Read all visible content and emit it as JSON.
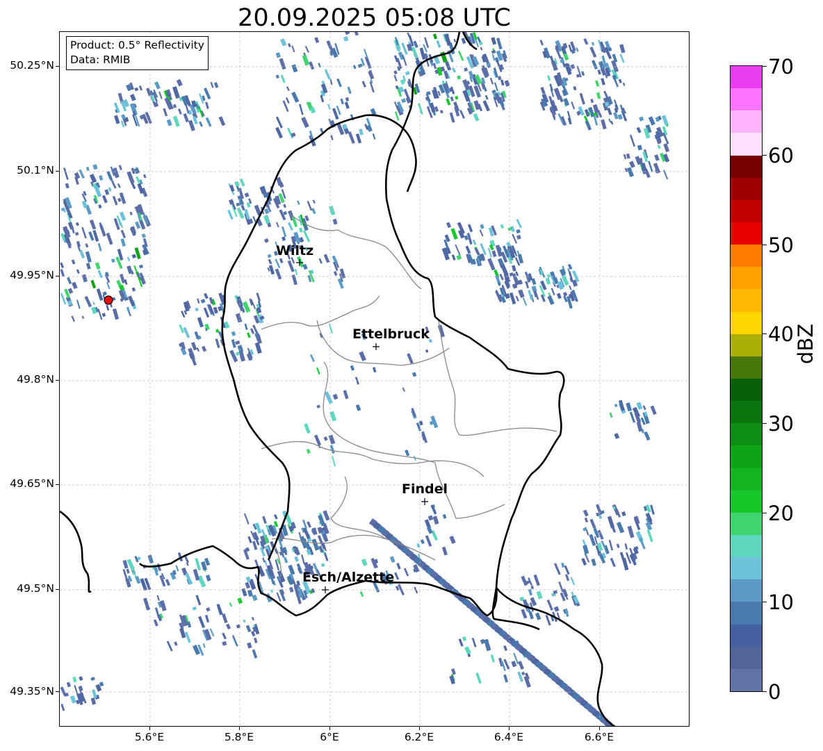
{
  "title": "20.09.2025 05:08 UTC",
  "info": {
    "product": "Product: 0.5° Reflectivity",
    "data": "Data: RMIB"
  },
  "axes": {
    "lat_labels": [
      "50.25°N",
      "50.1°N",
      "49.95°N",
      "49.8°N",
      "49.65°N",
      "49.5°N",
      "49.35°N"
    ],
    "lon_labels": [
      "5.6°E",
      "5.8°E",
      "6°E",
      "6.2°E",
      "6.4°E",
      "6.6°E"
    ]
  },
  "colorbar": {
    "label": "dBZ",
    "ticks": [
      "0",
      "10",
      "20",
      "30",
      "40",
      "50",
      "60",
      "70"
    ],
    "colors": [
      "#6473a6",
      "#52659b",
      "#4460a2",
      "#4a7aad",
      "#5b9ac4",
      "#6cc2d9",
      "#5fd6c0",
      "#3fd46e",
      "#16c72a",
      "#12b51e",
      "#0ea418",
      "#0d8d14",
      "#0b7510",
      "#086009",
      "#48770c",
      "#aaaf08",
      "#ffd500",
      "#ffb700",
      "#ff9f00",
      "#ff7d00",
      "#e60000",
      "#c30000",
      "#a10000",
      "#7a0000",
      "#ffe0ff",
      "#ffb6ff",
      "#ff74ff",
      "#ea3cf0"
    ]
  },
  "cities": [
    {
      "name": "Wiltz"
    },
    {
      "name": "Ettelbruck"
    },
    {
      "name": "Findel"
    },
    {
      "name": "Esch/Alzette"
    }
  ],
  "radar_site": {
    "color": "#e01010"
  }
}
